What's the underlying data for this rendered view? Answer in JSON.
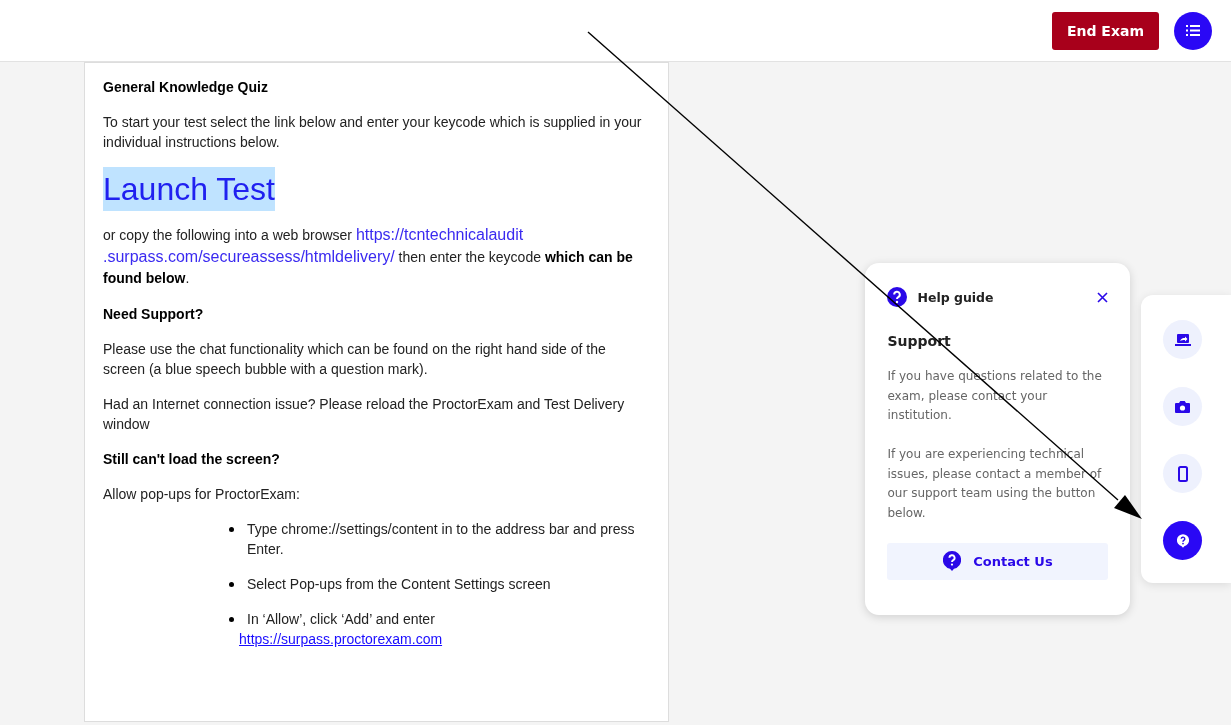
{
  "header": {
    "end_button": "End Exam"
  },
  "content": {
    "title": "General Knowledge Quiz",
    "intro": "To start your test select the link below and enter your keycode which is supplied in your individual instructions below.",
    "launch": {
      "label": "Launch Test",
      "selected": true
    },
    "copy_parts": [
      {
        "kind": "text",
        "text": "or copy the following into a web browser "
      },
      {
        "kind": "link",
        "text": "https://tcntechnicalaudit"
      },
      {
        "kind": "link",
        "text": ".surpass.com/secureassess/htmldelivery/"
      },
      {
        "kind": "text",
        "text": " then enter the keycode **which can be found below**."
      }
    ],
    "support_heading": "Need Support?",
    "support_text": "Please use the chat functionality which can be found on the right hand side of the screen (a blue speech bubble with a question mark).",
    "internet_text": "Had an Internet connection issue? Please reload the ProctorExam and Test Delivery window",
    "load_heading": "Still can't load the screen?",
    "popups_text": "Allow pop-ups for ProctorExam:",
    "steps": [
      {
        "text": "Type chrome://settings/content in to the address bar and press Enter."
      },
      {
        "text": "Select Pop-ups from the Content Settings screen"
      },
      {
        "text": "In ‘Allow’, click ‘Add’ and enter",
        "link": "https://surpass.proctorexam.com"
      }
    ]
  },
  "help_panel": {
    "title": "Help guide",
    "heading": "Support",
    "paragraphs": [
      "If you have questions related to the exam, please contact your institution.",
      "If you are experiencing technical issues, please contact a member of our support team using the button below."
    ],
    "contact_button": "Contact Us"
  },
  "side_tools": [
    {
      "kind": "screen",
      "selected": false
    },
    {
      "kind": "camera",
      "selected": false
    },
    {
      "kind": "phone",
      "selected": false
    },
    {
      "kind": "help",
      "selected": true
    }
  ]
}
